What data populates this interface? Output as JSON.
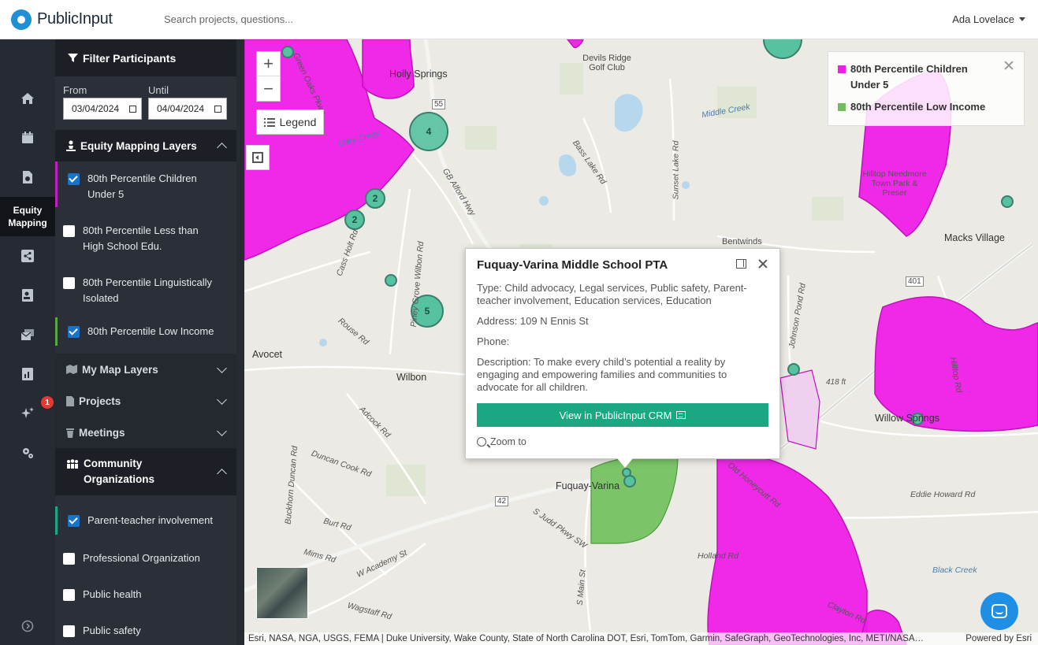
{
  "app": {
    "brand": "PublicInput",
    "search_placeholder": "Search projects, questions...",
    "user_name": "Ada Lovelace"
  },
  "rail": {
    "active_label": "Equity Mapping",
    "notification_count": "1"
  },
  "filter": {
    "header": "Filter Participants",
    "from_label": "From",
    "until_label": "Until",
    "from_value": "03/04/2024",
    "until_value": "04/04/2024"
  },
  "equity_layers": {
    "title": "Equity Mapping Layers",
    "items": [
      {
        "label": "80th Percentile Children Under 5",
        "checked": true,
        "accent": "#c21fc2"
      },
      {
        "label": "80th Percentile Less than High School Edu.",
        "checked": false
      },
      {
        "label": "80th Percentile Linguistically Isolated",
        "checked": false
      },
      {
        "label": "80th Percentile Low Income",
        "checked": true,
        "accent": "#5aa844"
      }
    ]
  },
  "sections": {
    "my_map_layers": "My Map Layers",
    "projects": "Projects",
    "meetings": "Meetings",
    "community_orgs": "Community Organizations"
  },
  "community_orgs": {
    "items": [
      {
        "label": "Parent-teacher involvement",
        "checked": true,
        "accent": "#1aa883"
      },
      {
        "label": "Professional Organization",
        "checked": false
      },
      {
        "label": "Public health",
        "checked": false
      },
      {
        "label": "Public safety",
        "checked": false
      }
    ]
  },
  "map": {
    "legend_button": "Legend",
    "legend": {
      "items": [
        {
          "label": "80th Percentile Children Under 5",
          "color": "#f01ee8"
        },
        {
          "label": "80th Percentile Low Income",
          "color": "#6fc05a"
        }
      ]
    },
    "clusters": [
      "4",
      "2",
      "2",
      "5"
    ],
    "labels": {
      "holly_springs": "Holly Springs",
      "devils_ridge": "Devils Ridge Golf Club",
      "avocet": "Avocet",
      "wilbon": "Wilbon",
      "fuquay": "Fuquay-Varina",
      "macks_village": "Macks Village",
      "willow_springs": "Willow Springs",
      "bentwinds": "Bentwinds",
      "hilltop": "Hilltop Needmore Town Park & Preser",
      "bass_lake_rd": "Bass Lake Rd",
      "gb_alford": "GB Alford Hwy",
      "sunset_lake": "Sunset Lake Rd",
      "cass_holt": "Cass Holt Rd",
      "piney_grove": "Piney Grove Wilbon Rd",
      "johnson_pond": "Johnson Pond Rd",
      "adcock": "Adcock Rd",
      "duncan_cook": "Duncan Cook Rd",
      "buckhorn": "Buckhorn Duncan Rd",
      "burt": "Burt Rd",
      "mims": "Mims Rd",
      "w_academy": "W Academy St",
      "wagstaff": "Wagstaff Rd",
      "s_main": "S Main St",
      "old_honeycutt": "Old Honeycutt Rd",
      "eddie_howard": "Eddie Howard Rd",
      "holland": "Holland Rd",
      "clayton": "Clayton Rd",
      "black_creek": "Black Creek",
      "hilltop_rd": "Hilltop Rd",
      "route_55": "55",
      "route_42": "42",
      "route_401": "401",
      "elev": "418 ft",
      "middle_creek": "Middle Creek",
      "utley_creek": "Utley Creek",
      "rouse": "Rouse Rd",
      "s_judd": "S Judd Pkwy SW",
      "green_oaks": "Green Oaks Pkwy"
    },
    "attribution": "Esri, NASA, NGA, USGS, FEMA | Duke University, Wake County, State of North Carolina DOT, Esri, TomTom, Garmin, SafeGraph, GeoTechnologies, Inc, METI/NASA…",
    "powered_by": "Powered by Esri"
  },
  "popup": {
    "title": "Fuquay-Varina Middle School PTA",
    "type": "Type: Child advocacy, Legal services, Public safety, Parent-teacher involvement, Education services, Education",
    "address": "Address: 109 N Ennis St",
    "phone": "Phone:",
    "description": "Description: To make every child’s potential a reality by engaging and empowering families and communities to advocate for all children.",
    "crm_button": "View in PublicInput CRM",
    "zoom_to": "Zoom to"
  }
}
